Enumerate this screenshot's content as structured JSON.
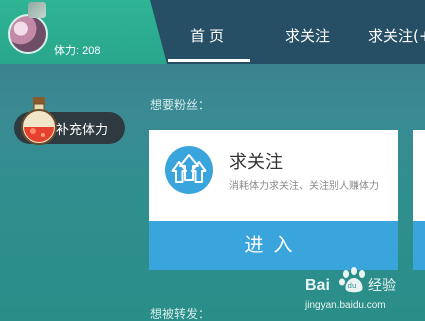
{
  "header": {
    "stamina_text": "体力: 208",
    "tabs": [
      {
        "label": "首页"
      },
      {
        "label": "求关注"
      },
      {
        "label": "求关注(+"
      }
    ]
  },
  "sidebar": {
    "refill_label": "补充体力"
  },
  "main": {
    "section_fans": "想要粉丝：",
    "section_repost": "想被转发：",
    "card": {
      "title": "求关注",
      "description": "消耗体力求关注、关注别人赚体力",
      "button_label": "进入"
    }
  },
  "watermark": {
    "logo_text": "Bai",
    "logo_text_2": "经验",
    "url": "jingyan.baidu.com"
  },
  "colors": {
    "accent_green": "#2fb494",
    "topbar": "#264f66",
    "button_blue": "#3aa4dd"
  },
  "icons": [
    "avatar",
    "potion-icon",
    "upload-arrows-icon",
    "baidu-paw-icon"
  ]
}
